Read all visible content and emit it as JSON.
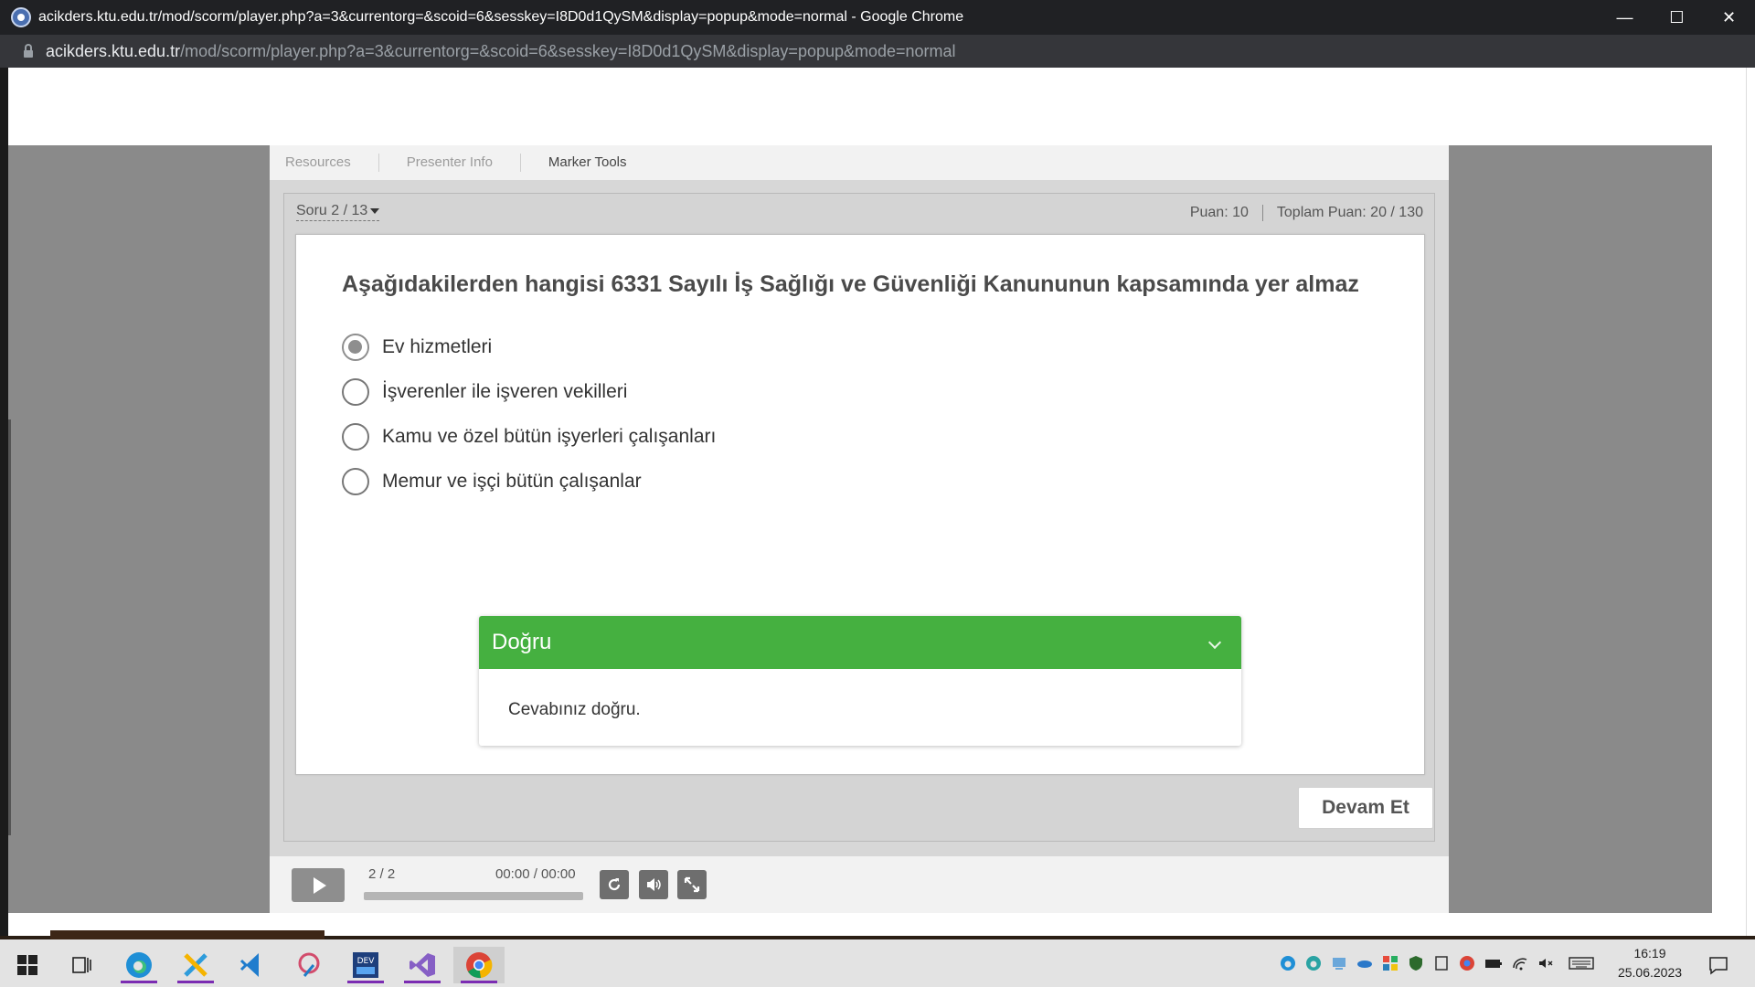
{
  "window": {
    "title": "acikders.ktu.edu.tr/mod/scorm/player.php?a=3&currentorg=&scoid=6&sesskey=I8D0d1QySM&display=popup&mode=normal - Google Chrome",
    "url_host": "acikders.ktu.edu.tr",
    "url_path": "/mod/scorm/player.php?a=3&currentorg=&scoid=6&sesskey=I8D0d1QySM&display=popup&mode=normal",
    "controls": {
      "minimize": "—",
      "maximize": "☐",
      "close": "✕"
    }
  },
  "player": {
    "nav": [
      "Resources",
      "Presenter Info",
      "Marker Tools"
    ],
    "question_nav": "Soru 2 / 13",
    "score": {
      "points": "Puan: 10",
      "total": "Toplam Puan: 20 / 130"
    },
    "question": "Aşağıdakilerden hangisi 6331 Sayılı İş Sağlığı ve Güvenliği Kanununun kapsamında yer almaz",
    "options": [
      {
        "label": "Ev hizmetleri",
        "selected": true
      },
      {
        "label": "İşverenler ile işveren vekilleri",
        "selected": false
      },
      {
        "label": "Kamu ve özel bütün işyerleri çalışanları",
        "selected": false
      },
      {
        "label": "Memur ve işçi bütün çalışanlar",
        "selected": false
      }
    ],
    "feedback": {
      "title": "Doğru",
      "body": "Cevabınız doğru.",
      "color": "#45b040"
    },
    "continue_label": "Devam Et",
    "controls": {
      "page": "2 / 2",
      "time": "00:00 / 00:00"
    }
  },
  "taskbar": {
    "apps": [
      "windows-start",
      "task-view",
      "edge",
      "xaml-tool",
      "vscode",
      "paint-3d",
      "devcpp",
      "visual-studio",
      "chrome"
    ],
    "time": "16:19",
    "date": "25.06.2023"
  }
}
